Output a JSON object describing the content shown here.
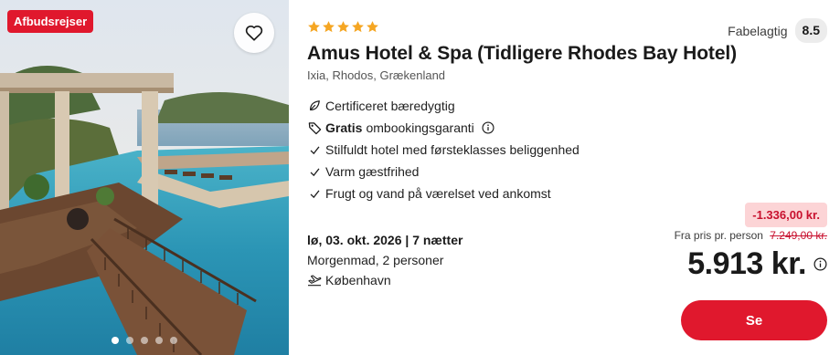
{
  "image": {
    "badge": "Afbudsrejser",
    "favorite_icon": "heart-icon",
    "carousel_dot_count": 5,
    "carousel_active_index": 0
  },
  "hotel": {
    "star_rating": 5,
    "rating_label": "Fabelagtig",
    "rating_score": "8.5",
    "name": "Amus Hotel & Spa (Tidligere Rhodes Bay Hotel)",
    "location": "Ixia, Rhodos, Grækenland"
  },
  "features": [
    {
      "icon": "leaf-icon",
      "text": "Certificeret bæredygtig"
    },
    {
      "icon": "tag-icon",
      "bold": "Gratis",
      "text": "ombookingsgaranti",
      "info_icon": true
    },
    {
      "icon": "check-icon",
      "text": "Stilfuldt hotel med førsteklasses beliggenhed"
    },
    {
      "icon": "check-icon",
      "text": "Varm gæstfrihed"
    },
    {
      "icon": "check-icon",
      "text": "Frugt og vand på værelset ved ankomst"
    }
  ],
  "trip": {
    "dates": "lø, 03. okt. 2026 | 7 nætter",
    "board": "Morgenmad, 2 personer",
    "departure_icon": "plane-takeoff-icon",
    "departure": "København"
  },
  "pricing": {
    "discount": "-1.336,00 kr.",
    "from_label": "Fra pris pr. person",
    "old_price": "7.249,00 kr.",
    "price": "5.913 kr."
  },
  "cta": {
    "label": "Se"
  },
  "colors": {
    "brand_red": "#e0182d",
    "star": "#f5a623",
    "discount_bg": "#fcd4d6",
    "discount_text": "#c8102e"
  }
}
